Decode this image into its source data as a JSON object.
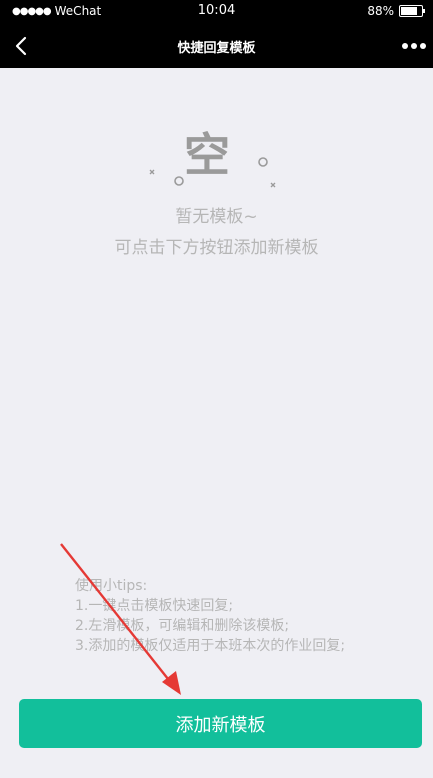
{
  "status_bar": {
    "signal_dots": "●●●●●",
    "carrier": "WeChat",
    "time": "10:04",
    "battery_text": "88%",
    "battery_level": 0.88
  },
  "nav": {
    "title": "快捷回复模板",
    "back_icon": "chevron-left-icon",
    "more_icon": "ellipsis-icon"
  },
  "empty_state": {
    "art_text": "空",
    "title": "暂无模板~",
    "subtitle": "可点击下方按钮添加新模板"
  },
  "tips": {
    "heading": "使用小tips:",
    "items": [
      "1.一键点击模板快速回复;",
      "2.左滑模板，可编辑和删除该模板;",
      "3.添加的模板仅适用于本班本次的作业回复;"
    ]
  },
  "add_button_label": "添加新模板",
  "colors": {
    "accent": "#12bf9b",
    "annotation_arrow": "#e53935"
  }
}
